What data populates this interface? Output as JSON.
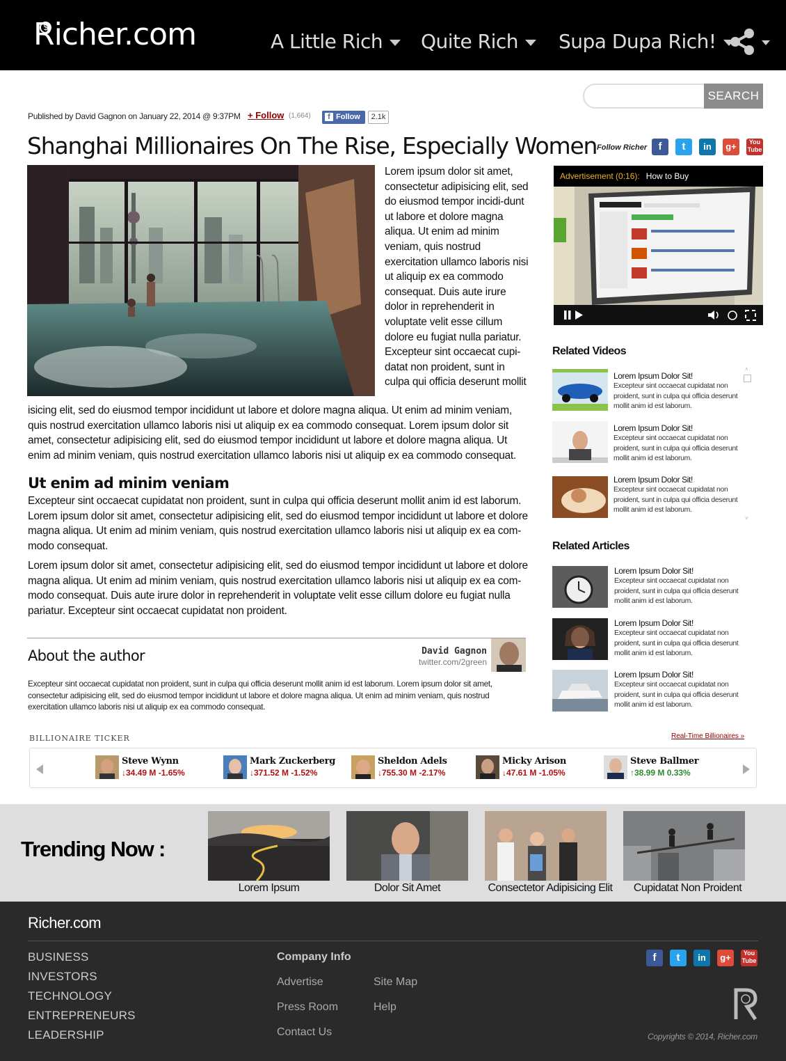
{
  "site": {
    "logo": "Richer.com",
    "logo_symbol": "$"
  },
  "nav": {
    "items": [
      "A Little Rich",
      "Quite Rich",
      "Supa Dupa Rich!"
    ]
  },
  "search": {
    "placeholder": "",
    "button": "SEARCH"
  },
  "article": {
    "byline": "Published by David Gagnon on January 22, 2014 @ 9:37PM",
    "follow_label": "Follow",
    "follow_count": "(1,664)",
    "fb_follow_label": "Follow",
    "fb_count": "2.1k",
    "title": "Shanghai Millionaires On The Rise, Especially Women",
    "para_a": "Lorem ipsum dolor sit amet, consectetur adipisicing elit, sed do eiusmod tempor incidi-dunt ut labore et dolore magna aliqua. Ut enim ad minim veniam, quis nostrud exercitation ullamco laboris nisi ut aliquip ex ea commodo consequat. Duis aute irure dolor in reprehenderit in voluptate velit esse cillum dolore eu fugiat nulla pariatur. Excepteur sint occaecat cupi-datat non proident, sunt in culpa qui officia deserunt mollit",
    "para_b": "isicing elit, sed do eiusmod tempor incididunt ut labore et dolore magna aliqua. Ut enim ad minim veniam, quis nostrud exercitation ullamco laboris nisi ut aliquip ex ea commodo consequat.  Lorem ipsum dolor sit amet, consectetur adipisicing elit, sed do eiusmod tempor incididunt ut labore et dolore magna aliqua. Ut enim ad minim veniam, quis nostrud exercitation ullamco laboris nisi ut aliquip ex ea commodo consequat.",
    "subheading": "Ut enim ad minim veniam",
    "para_c": "Excepteur sint occaecat cupidatat non proident, sunt in culpa qui officia deserunt mollit anim id est laborum. Lorem ipsum dolor sit amet, consectetur adipisicing elit, sed do eiusmod tempor incididunt ut labore et dolore magna aliqua. Ut enim ad minim veniam, quis nostrud exercitation ullamco laboris nisi ut aliquip ex ea com-modo consequat.",
    "para_d": "Lorem ipsum dolor sit amet, consectetur adipisicing elit, sed do eiusmod tempor incididunt ut labore et dolore magna aliqua. Ut enim ad minim veniam, quis nostrud exercitation ullamco laboris nisi ut aliquip ex ea com-modo consequat. Duis aute irure dolor in reprehenderit in voluptate velit esse cillum dolore eu fugiat nulla pariatur. Excepteur sint occaecat cupidatat non proident."
  },
  "author": {
    "section_title": "About the author",
    "name": "David Gagnon",
    "twitter": "twitter.com/2green",
    "bio": "Excepteur sint occaecat cupidatat non proident, sunt in culpa qui officia deserunt mollit anim id est laborum. Lorem ipsum dolor sit amet, consectetur adipisicing elit, sed do eiusmod tempor incididunt ut labore et dolore magna aliqua. Ut enim ad minim veniam, quis nostrud exercitation ullamco laboris nisi ut aliquip ex ea commodo consequat."
  },
  "sidebar": {
    "follow_label": "Follow Richer",
    "social_icons": [
      "facebook-icon",
      "twitter-icon",
      "linkedin-icon",
      "googleplus-icon",
      "youtube-icon"
    ],
    "video": {
      "ad_label": "Advertisement (0:16):",
      "title": "How to Buy"
    },
    "related_videos_title": "Related Videos",
    "related_videos": [
      {
        "title": "Lorem Ipsum Dolor Sit!",
        "text": "Excepteur sint occaecat cupidatat non proident, sunt in culpa qui officia deserunt mollit anim id est laborum."
      },
      {
        "title": "Lorem Ipsum Dolor Sit!",
        "text": "Excepteur sint occaecat cupidatat non proident, sunt in culpa qui officia deserunt mollit anim id est laborum."
      },
      {
        "title": "Lorem Ipsum Dolor Sit!",
        "text": "Excepteur sint occaecat cupidatat non proident, sunt in culpa qui officia deserunt mollit anim id est laborum."
      }
    ],
    "related_articles_title": "Related Articles",
    "related_articles": [
      {
        "title": "Lorem Ipsum Dolor Sit!",
        "text": "Excepteur sint occaecat cupidatat non proident, sunt in culpa qui officia deserunt mollit anim id est laborum."
      },
      {
        "title": "Lorem Ipsum Dolor Sit!",
        "text": "Excepteur sint occaecat cupidatat non proident, sunt in culpa qui officia deserunt mollit anim id est laborum."
      },
      {
        "title": "Lorem Ipsum Dolor Sit!",
        "text": "Excepteur sint occaecat cupidatat non proident, sunt in culpa qui officia deserunt mollit anim id est laborum."
      }
    ]
  },
  "ticker": {
    "label": "BILLIONAIRE TICKER",
    "link": "Real-Time Billionaires »",
    "items": [
      {
        "name": "Steve Wynn",
        "value": "34.49 M -1.65%",
        "dir": "down"
      },
      {
        "name": "Mark Zuckerberg",
        "value": "371.52 M -1.52%",
        "dir": "down"
      },
      {
        "name": "Sheldon Adelson",
        "value": "755.30 M -2.17%",
        "dir": "down"
      },
      {
        "name": "Micky Arison",
        "value": "47.61 M -1.05%",
        "dir": "down"
      },
      {
        "name": "Steve Ballmer",
        "value": "38.99 M 0.33%",
        "dir": "up"
      }
    ],
    "down_color": "#b01010",
    "up_color": "#2e8b2e"
  },
  "trending": {
    "title": "Trending Now :",
    "items": [
      "Lorem Ipsum",
      "Dolor Sit Amet",
      "Consectetor Adipisicing Elit",
      "Cupidatat Non Proident"
    ]
  },
  "footer": {
    "logo": "Richer.com",
    "categories": [
      "BUSINESS",
      "INVESTORS",
      "TECHNOLOGY",
      "ENTREPRENEURS",
      "LEADERSHIP"
    ],
    "company_info_title": "Company Info",
    "links_col1": [
      "Advertise",
      "Press Room",
      "Contact Us"
    ],
    "links_col2": [
      "Site Map",
      "Help"
    ],
    "copyright": "Copyrights © 2014, Richer.com"
  }
}
